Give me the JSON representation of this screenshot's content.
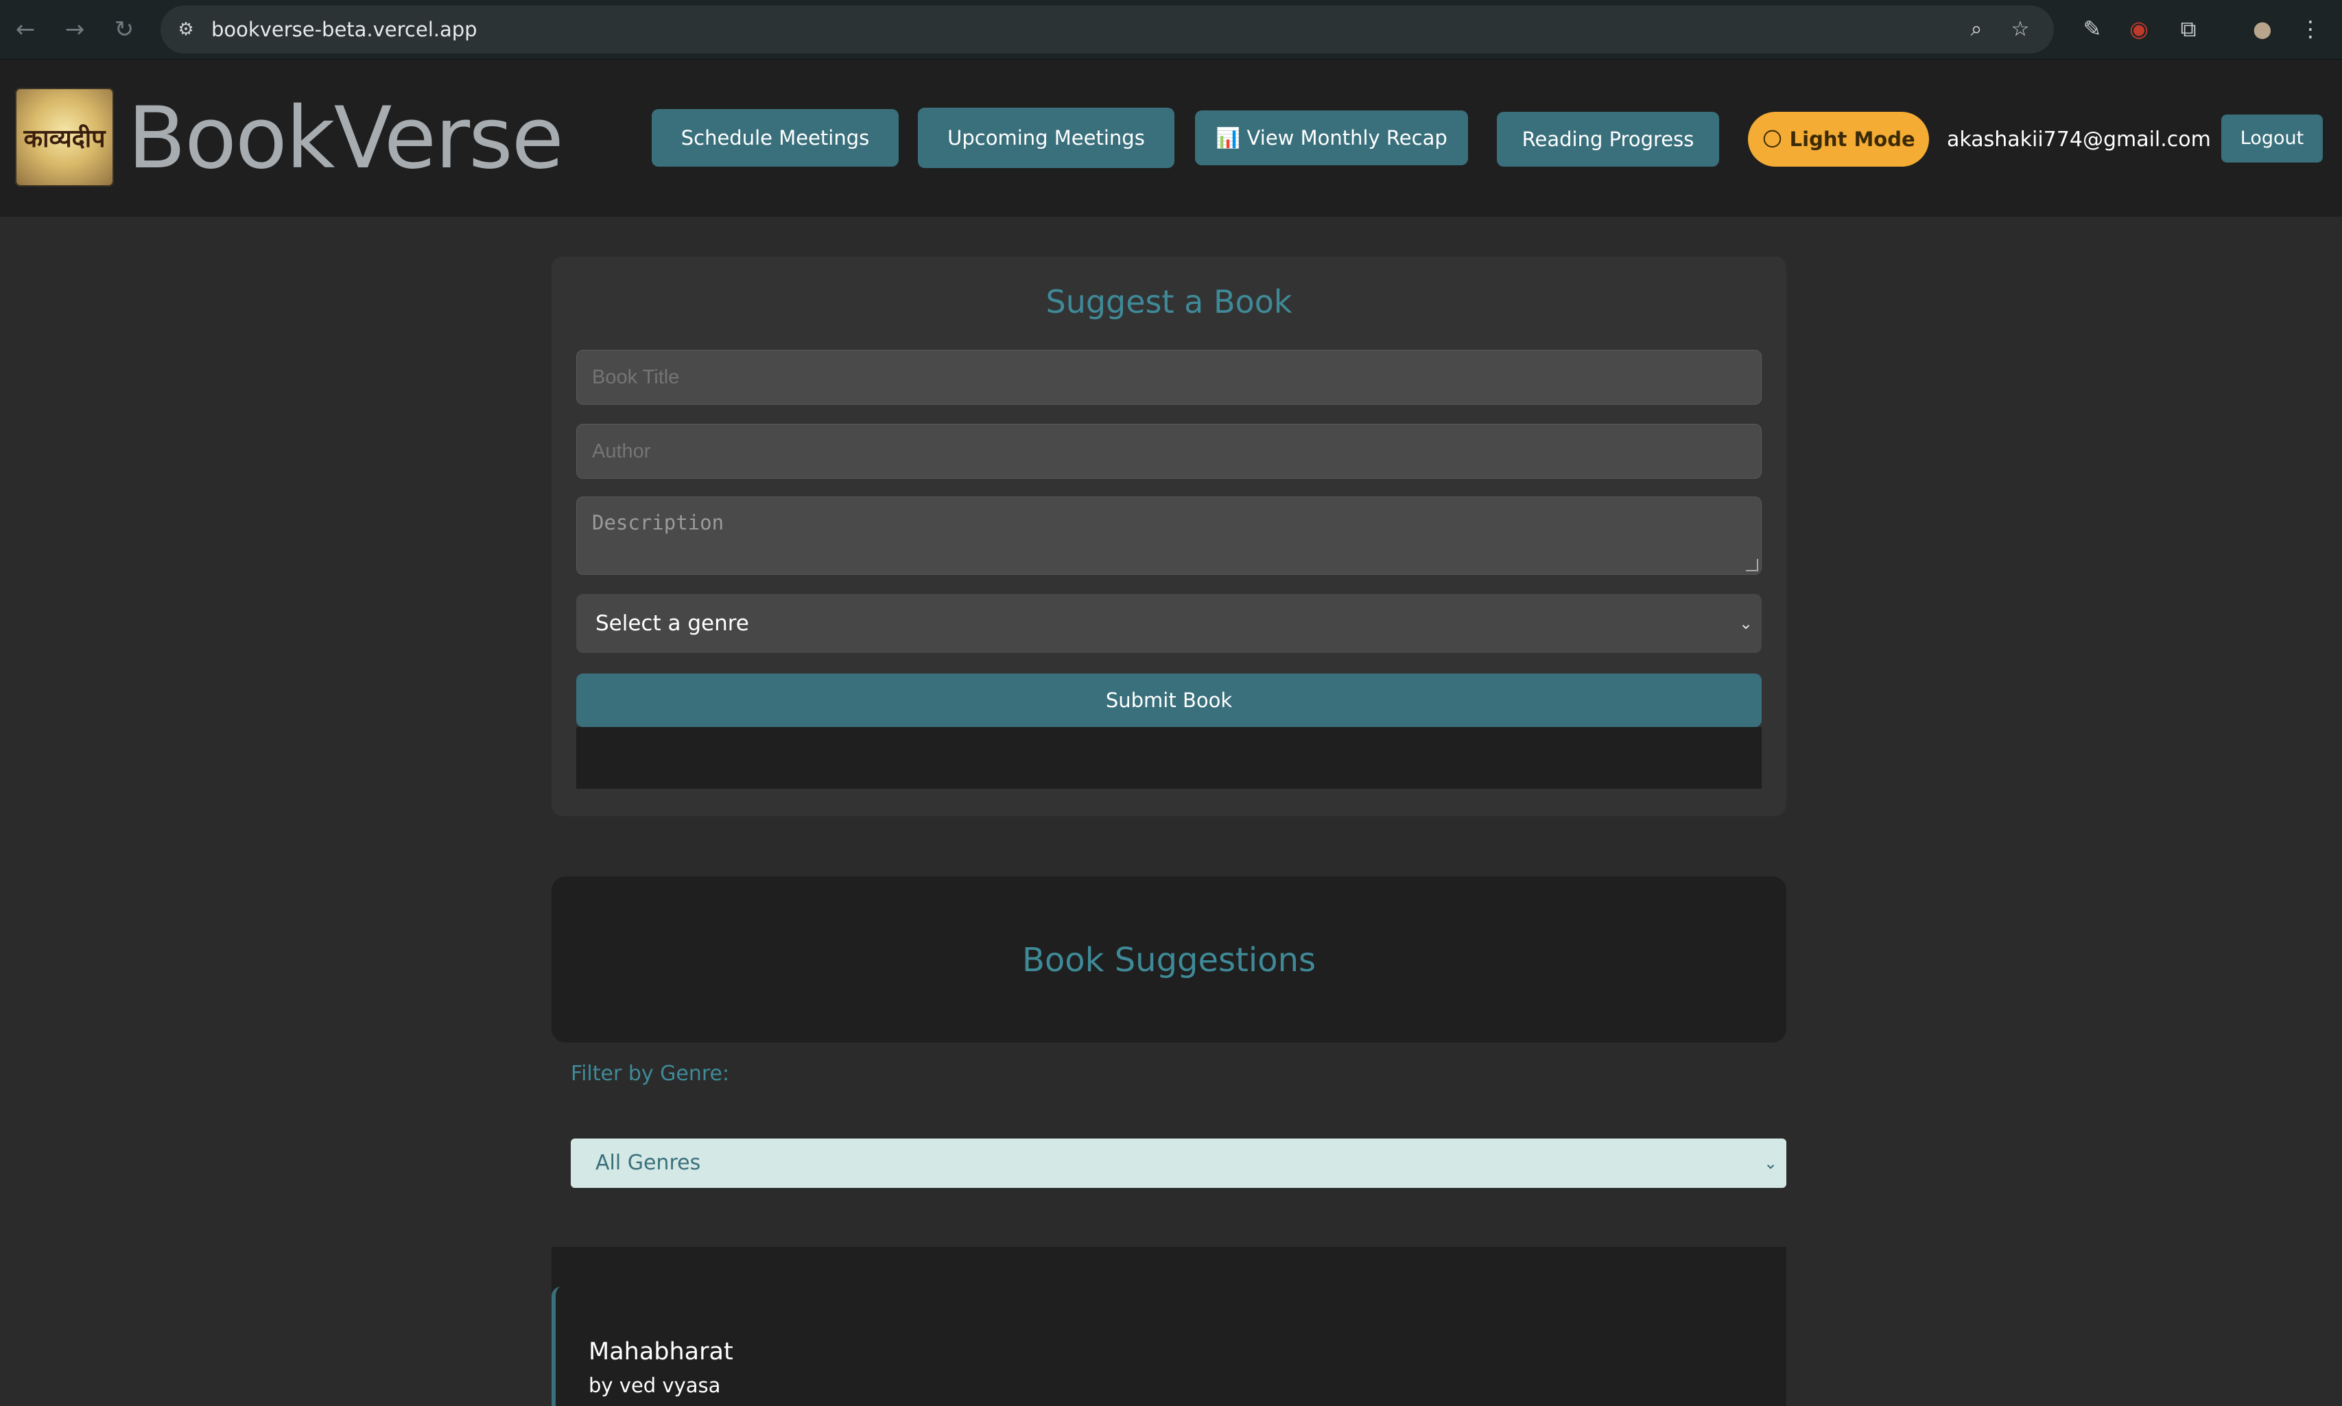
{
  "browser": {
    "url": "bookverse-beta.vercel.app",
    "icons": {
      "back": "←",
      "forward": "→",
      "reload": "↻",
      "site_info": "⚙",
      "zoom": "⌕",
      "bookmark": "☆",
      "ext1": "✎",
      "ext2": "◉",
      "extensions": "⧉",
      "profile": "●",
      "menu": "⋮"
    }
  },
  "header": {
    "logo_text": "काव्यदीप",
    "brand": "BookVerse",
    "buttons": {
      "schedule": "Schedule Meetings",
      "upcoming": "Upcoming Meetings",
      "recap": "📊 View Monthly Recap",
      "progress": "Reading Progress",
      "theme": "🌕 Light Mode",
      "logout": "Logout"
    },
    "email": "akashakii774@gmail.com"
  },
  "suggest": {
    "title": "Suggest a Book",
    "title_placeholder": "Book Title",
    "author_placeholder": "Author",
    "description_placeholder": "Description",
    "genre_selected": "Select a genre",
    "submit": "Submit Book"
  },
  "suggestions": {
    "title": "Book Suggestions",
    "filter_label": "Filter by Genre:",
    "filter_selected": "All Genres",
    "books": [
      {
        "title": "Mahabharat",
        "author": "by ved vyasa"
      }
    ]
  },
  "colors": {
    "accent": "#3a707c",
    "accent_text": "#3f8a98",
    "theme_button": "#f4ac34"
  }
}
